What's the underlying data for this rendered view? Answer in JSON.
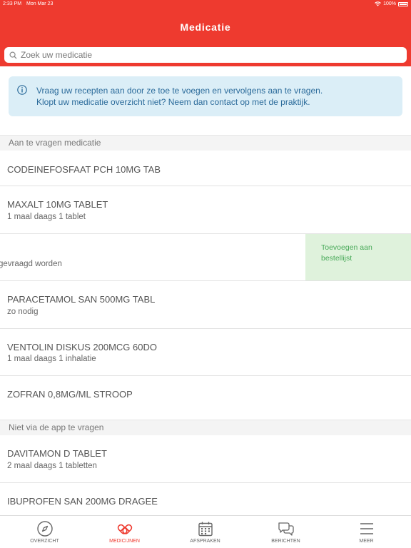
{
  "status_bar": {
    "time": "2:33 PM",
    "date": "Mon Mar 23",
    "battery": "100%"
  },
  "header": {
    "title": "Medicatie"
  },
  "search": {
    "placeholder": "Zoek uw medicatie"
  },
  "info": {
    "line1": "Vraag uw recepten aan door ze toe te voegen en vervolgens aan te vragen.",
    "line2": "Klopt uw medicatie overzicht niet? Neem dan contact op met de praktijk."
  },
  "sections": [
    {
      "title": "Aan te vragen medicatie",
      "items": [
        {
          "name": "CODEINEFOSFAAT PCH 10MG TAB",
          "sub": ""
        },
        {
          "name": "MAXALT 10MG TABLET",
          "sub": "1 maal daags 1 tablet"
        },
        {
          "name": "",
          "sub": "gevraagd worden",
          "action": "Toevoegen aan bestellijst"
        },
        {
          "name": "PARACETAMOL SAN 500MG TABL",
          "sub": "zo nodig"
        },
        {
          "name": "VENTOLIN DISKUS 200MCG 60DO",
          "sub": "1 maal daags 1 inhalatie"
        },
        {
          "name": "ZOFRAN 0,8MG/ML STROOP",
          "sub": ""
        }
      ]
    },
    {
      "title": "Niet via de app te vragen",
      "items": [
        {
          "name": "DAVITAMON D TABLET",
          "sub": "2 maal daags 1 tabletten"
        },
        {
          "name": "IBUPROFEN SAN 200MG DRAGEE",
          "sub": ""
        }
      ]
    }
  ],
  "tabs": [
    {
      "label": "OVERZICHT",
      "icon": "compass-icon",
      "active": false
    },
    {
      "label": "MEDICIJNEN",
      "icon": "pills-icon",
      "active": true
    },
    {
      "label": "AFSPRAKEN",
      "icon": "calendar-icon",
      "active": false
    },
    {
      "label": "BERICHTEN",
      "icon": "chat-bubbles-icon",
      "active": false
    },
    {
      "label": "MEER",
      "icon": "menu-icon",
      "active": false
    }
  ],
  "colors": {
    "brand": "#ee3a2f",
    "info_bg": "#dbeef7",
    "info_text": "#2a6a9a",
    "action_bg": "#dff2dc",
    "action_text": "#4aaa5a"
  }
}
